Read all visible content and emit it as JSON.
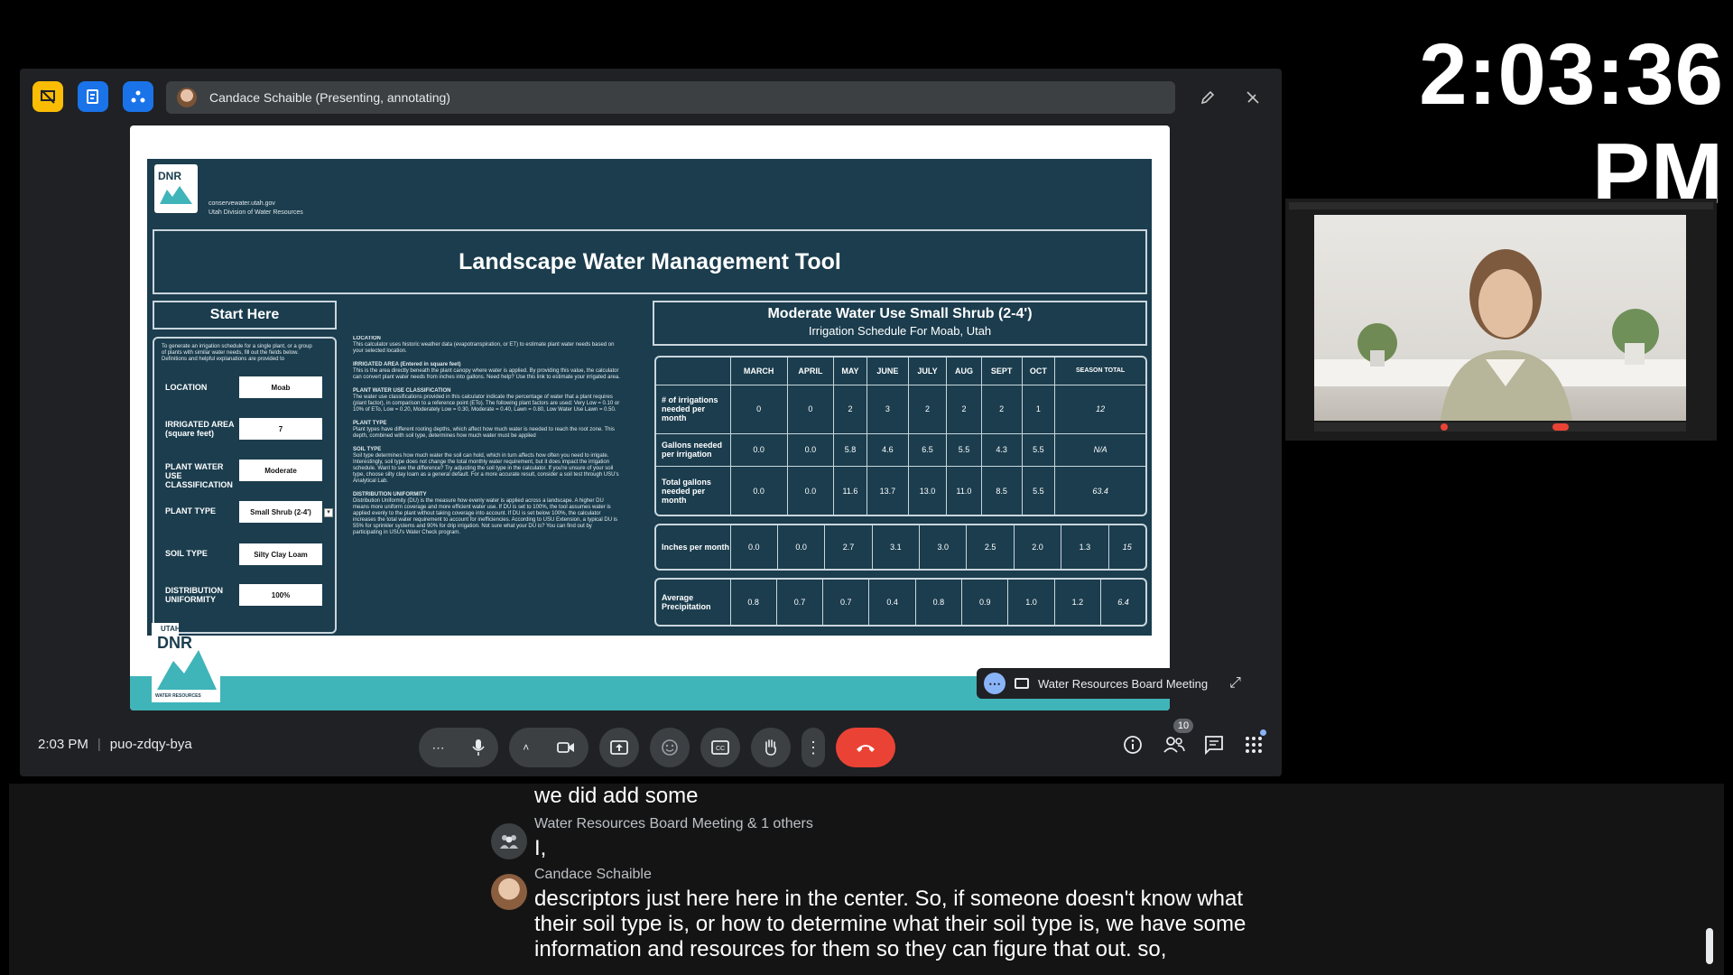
{
  "clock": {
    "time": "2:03:36 PM"
  },
  "meet": {
    "presenter_label": "Candace Schaible (Presenting, annotating)",
    "meeting_time": "2:03 PM",
    "meeting_code": "puo-zdqy-bya",
    "participant_count": "10",
    "pip_title": "Water Resources Board Meeting",
    "icons": {
      "activities": "present-off-icon",
      "notes": "notes-icon",
      "gemini": "ai-assist-icon",
      "pen": "pen-icon",
      "annotate_off": "annotate-off-icon"
    }
  },
  "slide": {
    "org_url": "conservewater.utah.gov",
    "org_name": "Utah Division of Water Resources",
    "logo_text": "DNR",
    "logo_small": "UTAH",
    "logo_caption": "WATER RESOURCES",
    "title": "Landscape Water Management Tool",
    "start_here": "Start Here",
    "intro": "To generate an irrigation schedule for a single plant, or a group of plants with similar water needs, fill out the fields below. Definitions and helpful explanations are provided to",
    "inputs": [
      {
        "label": "LOCATION",
        "value": "Moab"
      },
      {
        "label": "IRRIGATED AREA (square feet)",
        "value": "7"
      },
      {
        "label": "PLANT WATER USE CLASSIFICATION",
        "value": "Moderate"
      },
      {
        "label": "PLANT TYPE",
        "value": "Small Shrub (2-4')"
      },
      {
        "label": "SOIL TYPE",
        "value": "Silty Clay Loam"
      },
      {
        "label": "DISTRIBUTION UNIFORMITY",
        "value": "100%"
      }
    ],
    "definitions": [
      {
        "heading": "LOCATION",
        "text": "This calculator uses historic weather data (evapotranspiration, or ET) to estimate plant water needs based on your selected location."
      },
      {
        "heading": "IRRIGATED AREA (Entered in square feet)",
        "text": "This is the area directly beneath the plant canopy where water is applied. By providing this value, the calculator can convert plant water needs from inches into gallons. Need help? Use this link to estimate your irrigated area."
      },
      {
        "heading": "PLANT WATER USE CLASSIFICATION",
        "text": "The water use classifications provided in this calculator indicate the percentage of water that a plant requires (plant factor), in comparison to a reference point (ETo). The following plant factors are used: Very Low = 0.10 or 10% of ETo, Low = 0.20, Moderately Low = 0.30, Moderate = 0.40, Lawn = 0.80, Low Water Use Lawn = 0.50."
      },
      {
        "heading": "PLANT TYPE",
        "text": "Plant types have different rooting depths, which affect how much water is needed to reach the root zone. This depth, combined with soil type, determines how much water must be applied"
      },
      {
        "heading": "SOIL TYPE",
        "text": "Soil type determines how much water the soil can hold, which in turn affects how often you need to irrigate. Interestingly, soil type does not change the total monthly water requirement, but it does impact the irrigation schedule. Want to see the difference? Try adjusting the soil type in the calculator. If you're unsure of your soil type, choose silty clay loam as a general default. For a more accurate result, consider a soil test through USU's Analytical Lab."
      },
      {
        "heading": "DISTRIBUTION UNIFORMITY",
        "text": "Distribution Uniformity (DU) is the measure how evenly water is applied across a landscape. A higher DU means more uniform coverage and more efficient water use. If DU is set to 100%, the tool assumes water is applied evenly to the plant without taking coverage into account. If DU is set below 100%, the calculator increases the total water requirement to account for inefficiencies. According to USU Extension, a typical DU is 55% for sprinkler systems and 90% for drip irrigation. Not sure what your DU is? You can find out by participating in USU's Water Check program."
      }
    ],
    "schedule_title": "Moderate Water Use Small Shrub (2-4')",
    "schedule_subtitle": "Irrigation Schedule For Moab, Utah",
    "months": [
      "MARCH",
      "APRIL",
      "MAY",
      "JUNE",
      "JULY",
      "AUG",
      "SEPT",
      "OCT",
      "SEASON TOTAL"
    ],
    "main_rows": [
      {
        "label": "# of irrigations needed per month",
        "values": [
          "0",
          "0",
          "2",
          "3",
          "2",
          "2",
          "2",
          "1",
          "12"
        ]
      },
      {
        "label": "Gallons needed per irrigation",
        "values": [
          "0.0",
          "0.0",
          "5.8",
          "4.6",
          "6.5",
          "5.5",
          "4.3",
          "5.5",
          "N/A"
        ]
      },
      {
        "label": "Total gallons needed per month",
        "values": [
          "0.0",
          "0.0",
          "11.6",
          "13.7",
          "13.0",
          "11.0",
          "8.5",
          "5.5",
          "63.4"
        ]
      }
    ],
    "inches_row": {
      "label": "Inches per month",
      "values": [
        "0.0",
        "0.0",
        "2.7",
        "3.1",
        "3.0",
        "2.5",
        "2.0",
        "1.3",
        "15"
      ]
    },
    "precip_row": {
      "label": "Average Precipitation",
      "values": [
        "0.8",
        "0.7",
        "0.7",
        "0.4",
        "0.8",
        "0.9",
        "1.0",
        "1.2",
        "6.4"
      ]
    }
  },
  "controls": {
    "more": "more-options-icon",
    "mic": "microphone-icon",
    "camera": "camera-icon",
    "present": "present-screen-icon",
    "emoji": "emoji-icon",
    "captions": "captions-icon",
    "hand": "raise-hand-icon",
    "more_vert": "more-vertical-icon",
    "end": "end-call-icon",
    "info": "info-icon",
    "people": "people-icon",
    "chat": "chat-icon",
    "apps": "apps-icon"
  },
  "captions": [
    {
      "speaker": "",
      "text": "we did add some"
    },
    {
      "speaker": "Water Resources Board Meeting & 1 others",
      "text": "I,"
    },
    {
      "speaker": "Candace Schaible",
      "text": "descriptors just here here in the center. So, if someone doesn't know what their soil type is, or how to determine what their soil type is, we have some information and resources for them so they can figure that out. so,"
    }
  ],
  "colors": {
    "meet_bg": "#202124",
    "slide_bg": "#1b3d4e",
    "accent_teal": "#3fb4b9",
    "end_call": "#ea4335",
    "btn_blue": "#1a73e8",
    "btn_yellow": "#fbbc04"
  }
}
